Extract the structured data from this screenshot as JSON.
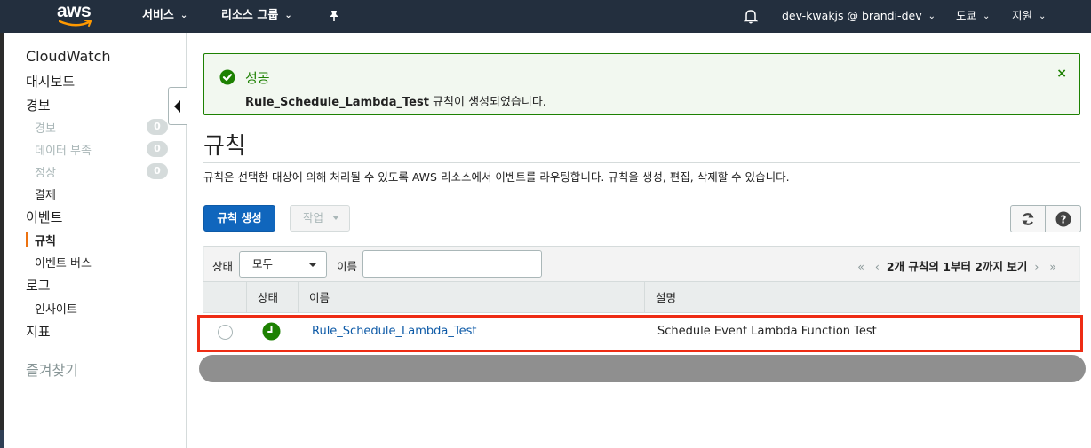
{
  "topnav": {
    "logo": "aws",
    "services": "서비스",
    "resource_groups": "리소스 그룹",
    "pin_icon": "pushpin-icon",
    "bell_icon": "bell-icon",
    "account": "dev-kwakjs @ brandi-dev",
    "region": "도쿄",
    "support": "지원"
  },
  "sidebar": {
    "cloudwatch": "CloudWatch",
    "dashboards": "대시보드",
    "alarms": "경보",
    "alarm_items": [
      {
        "label": "경보",
        "count": "0"
      },
      {
        "label": "데이터 부족",
        "count": "0"
      },
      {
        "label": "정상",
        "count": "0"
      }
    ],
    "billing": "결제",
    "events": "이벤트",
    "rules": "규칙",
    "event_buses": "이벤트 버스",
    "logs": "로그",
    "insights": "인사이트",
    "metrics": "지표",
    "favorites": "즐겨찾기"
  },
  "flash": {
    "title": "성공",
    "rule_name": "Rule_Schedule_Lambda_Test",
    "message_suffix": " 규칙이 생성되었습니다.",
    "close": "×"
  },
  "page": {
    "title": "규칙",
    "description": "규칙은 선택한 대상에 의해 처리될 수 있도록 AWS 리소스에서 이벤트를 라우팅합니다. 규칙을 생성, 편집, 삭제할 수 있습니다.",
    "create_button": "규칙 생성",
    "actions_button": "작업"
  },
  "table": {
    "filter_state_label": "상태",
    "filter_state_value": "모두",
    "filter_name_label": "이름",
    "pager_text": "2개 규칙의 1부터 2까지 보기",
    "columns": [
      "상태",
      "이름",
      "설명"
    ],
    "rows": [
      {
        "name": "Rule_Schedule_Lambda_Test",
        "description": "Schedule Event Lambda Function Test",
        "status": "enabled"
      }
    ]
  },
  "colors": {
    "nav_bg": "#232f3e",
    "primary": "#1066bd",
    "success": "#1d8102",
    "highlight": "#ee2c14"
  }
}
